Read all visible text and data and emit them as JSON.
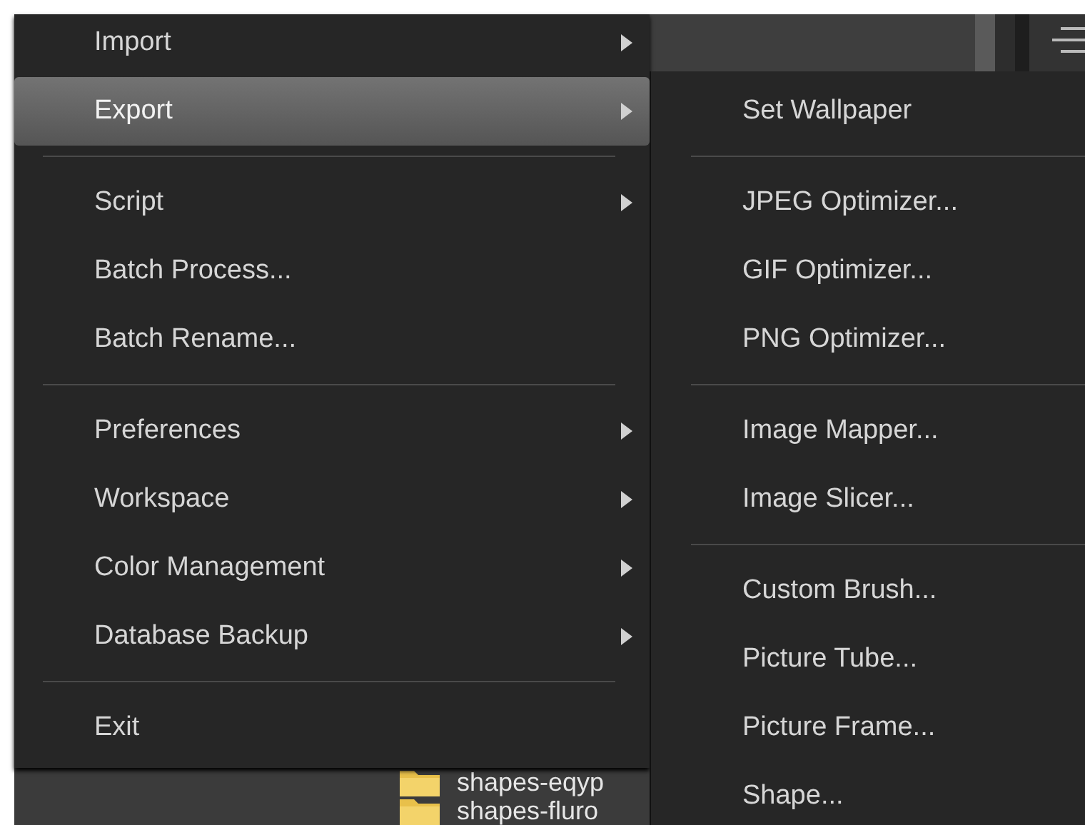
{
  "menu": {
    "items": [
      {
        "kind": "item",
        "label": "Import",
        "submenu": true,
        "selected": false
      },
      {
        "kind": "item",
        "label": "Export",
        "submenu": true,
        "selected": true
      },
      {
        "kind": "separator"
      },
      {
        "kind": "item",
        "label": "Script",
        "submenu": true,
        "selected": false
      },
      {
        "kind": "item",
        "label": "Batch Process...",
        "submenu": false,
        "selected": false
      },
      {
        "kind": "item",
        "label": "Batch Rename...",
        "submenu": false,
        "selected": false
      },
      {
        "kind": "separator"
      },
      {
        "kind": "item",
        "label": "Preferences",
        "submenu": true,
        "selected": false
      },
      {
        "kind": "item",
        "label": "Workspace",
        "submenu": true,
        "selected": false
      },
      {
        "kind": "item",
        "label": "Color Management",
        "submenu": true,
        "selected": false
      },
      {
        "kind": "item",
        "label": "Database Backup",
        "submenu": true,
        "selected": false
      },
      {
        "kind": "separator"
      },
      {
        "kind": "item",
        "label": "Exit",
        "submenu": false,
        "selected": false
      }
    ]
  },
  "submenu": {
    "items": [
      {
        "kind": "item",
        "label": "Set Wallpaper",
        "submenu": false,
        "selected": false
      },
      {
        "kind": "separator"
      },
      {
        "kind": "item",
        "label": "JPEG Optimizer...",
        "submenu": false,
        "selected": false
      },
      {
        "kind": "item",
        "label": "GIF Optimizer...",
        "submenu": false,
        "selected": false
      },
      {
        "kind": "item",
        "label": "PNG Optimizer...",
        "submenu": false,
        "selected": false
      },
      {
        "kind": "separator"
      },
      {
        "kind": "item",
        "label": "Image Mapper...",
        "submenu": false,
        "selected": false
      },
      {
        "kind": "item",
        "label": "Image Slicer...",
        "submenu": false,
        "selected": false
      },
      {
        "kind": "separator"
      },
      {
        "kind": "item",
        "label": "Custom Brush...",
        "submenu": false,
        "selected": false
      },
      {
        "kind": "item",
        "label": "Picture Tube...",
        "submenu": false,
        "selected": false
      },
      {
        "kind": "item",
        "label": "Picture Frame...",
        "submenu": false,
        "selected": false
      },
      {
        "kind": "item",
        "label": "Shape...",
        "submenu": false,
        "selected": false
      }
    ]
  },
  "folders": [
    {
      "name": "shapes-eqyp"
    },
    {
      "name": "shapes-fluro"
    }
  ]
}
